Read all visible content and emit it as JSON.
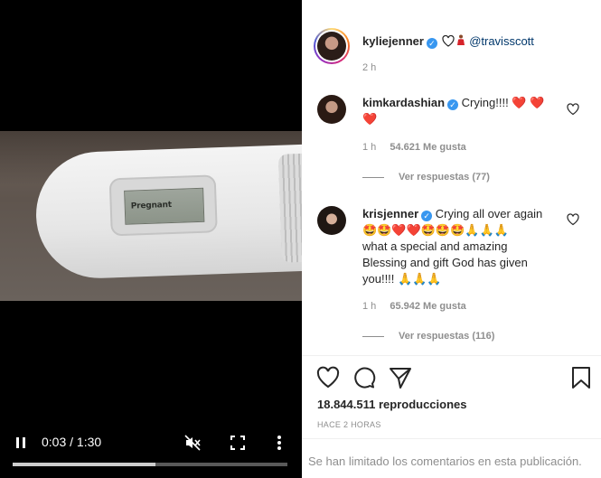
{
  "video": {
    "screen_text": "Pregnant",
    "time_display": "0:03 / 1:30",
    "progress_fraction": 0.52
  },
  "post": {
    "username": "kyliejenner",
    "verified_mark": "✓",
    "caption_mention": "@travisscott",
    "time_ago": "2 h"
  },
  "comments": [
    {
      "username": "kimkardashian",
      "text_line1": "Crying!!!!",
      "hearts_line1": "❤️ ❤️",
      "hearts_line2": "❤️",
      "time": "1 h",
      "likes": "54.621 Me gusta",
      "replies": "Ver respuestas (77)"
    },
    {
      "username": "krisjenner",
      "text_line1": "Crying all over again",
      "emoji_line": "🤩🤩❤️❤️🤩🤩🤩🙏🙏🙏",
      "text_line3": "what a special and amazing",
      "text_line4": "Blessing and gift God has given",
      "text_line5": "you!!!!",
      "emoji_line2": "🙏🙏🙏",
      "time": "1 h",
      "likes": "65.942 Me gusta",
      "replies": "Ver respuestas (116)"
    }
  ],
  "footer": {
    "views": "18.844.511 reproducciones",
    "posted": "HACE 2 HORAS",
    "comments_limited": "Se han limitado los comentarios en esta publicación."
  },
  "icons": {
    "like": "heart-icon",
    "comment": "comment-icon",
    "share": "share-icon",
    "save": "bookmark-icon"
  }
}
